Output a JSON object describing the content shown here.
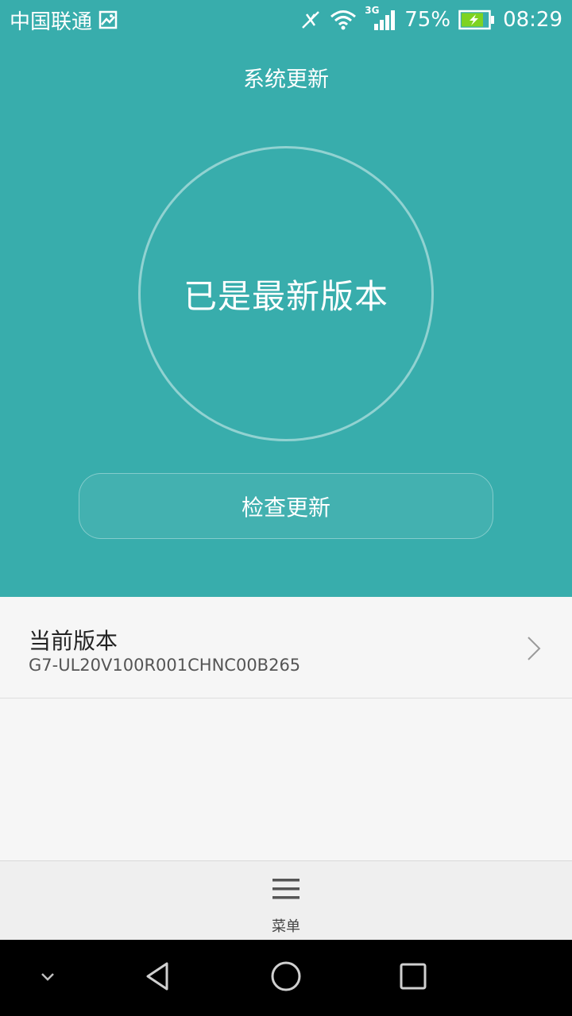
{
  "status_bar": {
    "carrier": "中国联通",
    "network": "3G",
    "battery": "75%",
    "time": "08:29"
  },
  "header": {
    "title": "系统更新"
  },
  "status_circle": {
    "text": "已是最新版本"
  },
  "check_button": {
    "label": "检查更新"
  },
  "current_version": {
    "title": "当前版本",
    "value": "G7-UL20V100R001CHNC00B265"
  },
  "menu": {
    "label": "菜单"
  },
  "colors": {
    "accent": "#38ADAC",
    "content_bg": "#F6F6F6",
    "menu_bg": "#EFEFEF",
    "battery_fill": "#7ED321"
  }
}
